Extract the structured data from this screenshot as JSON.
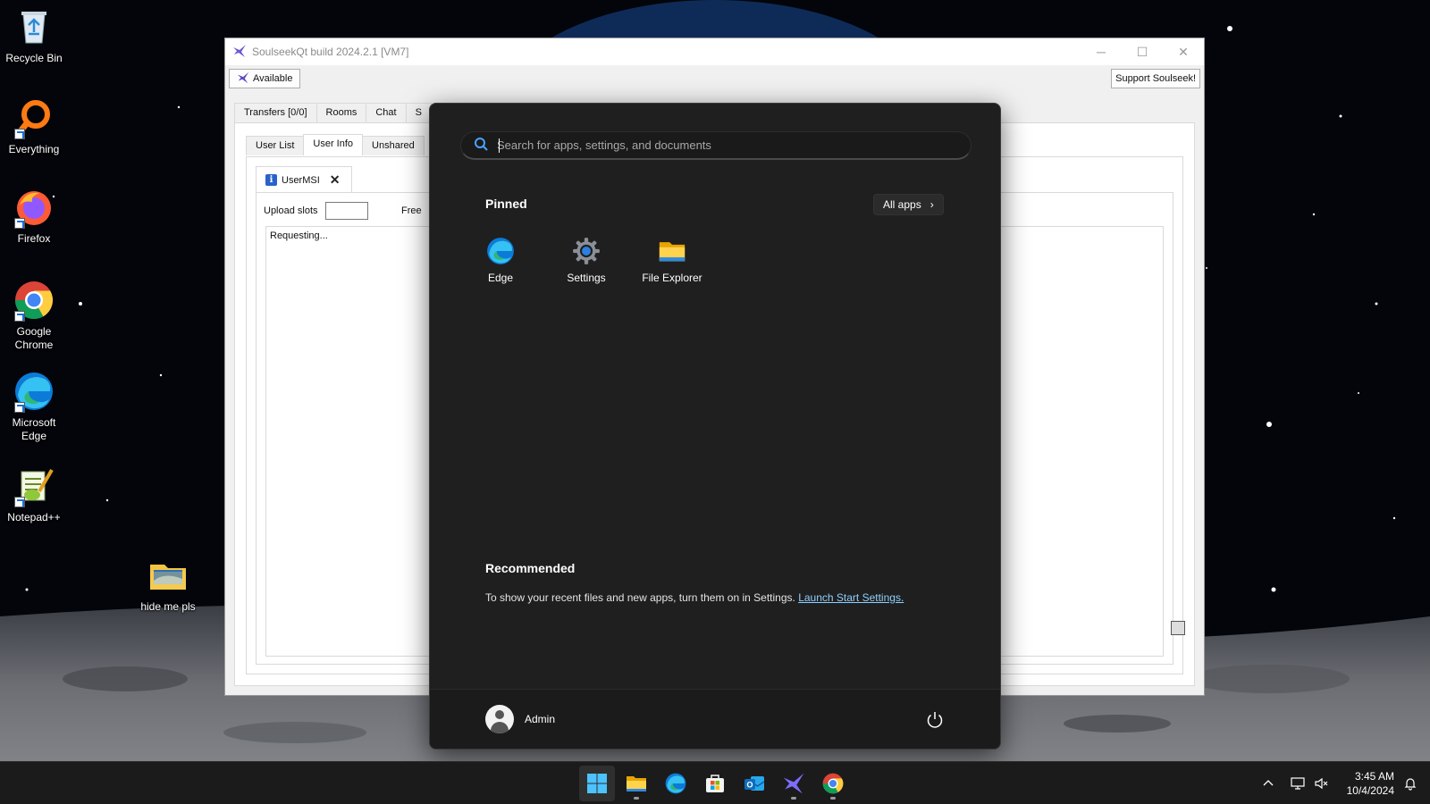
{
  "desktop": {
    "icons": [
      {
        "name": "recycle-bin",
        "label": "Recycle Bin"
      },
      {
        "name": "everything",
        "label": "Everything"
      },
      {
        "name": "firefox",
        "label": "Firefox"
      },
      {
        "name": "google-chrome",
        "label": "Google Chrome"
      },
      {
        "name": "microsoft-edge",
        "label": "Microsoft Edge"
      },
      {
        "name": "notepad-plus-plus",
        "label": "Notepad++"
      },
      {
        "name": "folder",
        "label": "hide me pls"
      }
    ]
  },
  "soulseek": {
    "title": "SoulseekQt build 2024.2.1 [VM7]",
    "status_button": "Available",
    "support_button": "Support Soulseek!",
    "main_tabs": [
      "Transfers [0/0]",
      "Rooms",
      "Chat",
      "S"
    ],
    "sub_tabs": [
      "User List",
      "User Info",
      "Unshared"
    ],
    "user_tab": "UserMSI",
    "upload_slots_label": "Upload slots",
    "free_label": "Free",
    "status_text": "Requesting..."
  },
  "start_menu": {
    "search_placeholder": "Search for apps, settings, and documents",
    "pinned_title": "Pinned",
    "all_apps_label": "All apps",
    "pinned_apps": [
      {
        "label": "Edge",
        "icon": "edge-icon"
      },
      {
        "label": "Settings",
        "icon": "settings-gear-icon"
      },
      {
        "label": "File Explorer",
        "icon": "folder-icon"
      }
    ],
    "recommended_title": "Recommended",
    "recommended_text": "To show your recent files and new apps, turn them on in Settings.",
    "recommended_link": "Launch Start Settings.",
    "user_name": "Admin"
  },
  "taskbar": {
    "apps": [
      "start-icon",
      "file-explorer-icon",
      "edge-icon",
      "store-icon",
      "outlook-icon",
      "soulseek-icon",
      "chrome-icon"
    ],
    "time": "3:45 AM",
    "date": "10/4/2024"
  },
  "colors": {
    "start_bg": "#1f1f1f",
    "link": "#8fd0ff",
    "taskbar_bg": "#1b1b1b"
  }
}
